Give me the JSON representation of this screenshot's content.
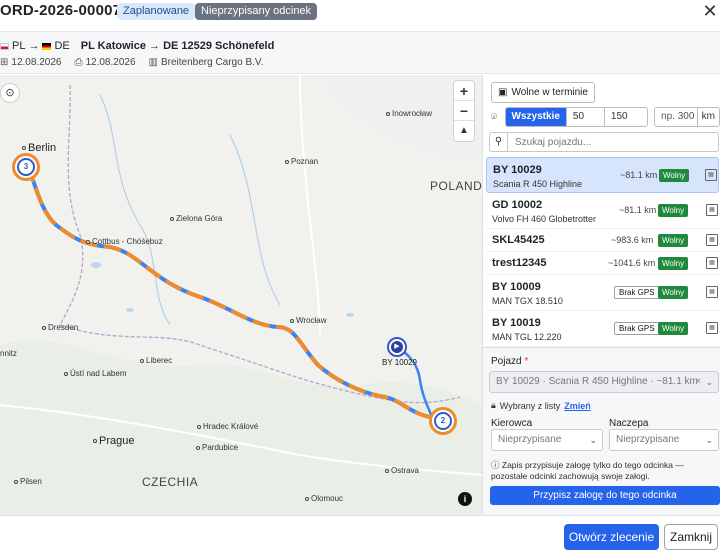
{
  "header": {
    "order_id": "ORD-2026-00007",
    "badge_planned": "Zaplanowane",
    "badge_unassigned": "Nieprzypisany odcinek",
    "close_icon": "close-icon"
  },
  "route": {
    "from_code": "PL",
    "to_code": "DE",
    "arrow": "→",
    "summary": "PL Katowice → DE 12529 Schönefeld",
    "pickup_date": "12.08.2026",
    "delivery_date": "12.08.2026",
    "client": "Breitenberg Cargo B.V."
  },
  "map": {
    "labels": {
      "berlin": "Berlin",
      "poznan": "Poznan",
      "poland": "POLAND",
      "inowroclaw": "Inowrocław",
      "zielona_gora": "Zielona Góra",
      "cottbus": "Cottbus - Chóśebuz",
      "wroclaw": "Wrocław",
      "dresden": "Dresden",
      "nnitz": "nnitz",
      "liberec": "Liberec",
      "usti": "Ústí nad Labem",
      "prague": "Prague",
      "hradec": "Hradec Králové",
      "pardubice": "Pardubice",
      "czechia": "CZECHIA",
      "plzen": "Pilsen",
      "ostrava": "Ostrava",
      "olomouc": "Olomouc"
    },
    "cluster_start": "3",
    "cluster_end": "2",
    "vehicle_marker_label": "BY 10029",
    "zoom_in": "+",
    "zoom_out": "−",
    "compass": "▲",
    "route_color": "#3b82f6",
    "route_highlight_color": "#f08a2a"
  },
  "filters": {
    "free_on_time": "Wolne w terminie",
    "radius_options": [
      "Wszystkie",
      "50 km",
      "150 km"
    ],
    "radius_active": "Wszystkie",
    "km_placeholder": "np. 300",
    "km_unit": "km",
    "search_placeholder": "Szukaj pojazdu..."
  },
  "vehicles": [
    {
      "plate": "BY 10029",
      "model": "Scania R 450 Highline",
      "distance": "~81.1 km",
      "status": "Wolny",
      "gps": "",
      "selected": true
    },
    {
      "plate": "GD 10002",
      "model": "Volvo FH 460 Globetrotter",
      "distance": "~81.1 km",
      "status": "Wolny",
      "gps": ""
    },
    {
      "plate": "SKL45425",
      "model": "",
      "distance": "~983.6 km",
      "status": "Wolny",
      "gps": ""
    },
    {
      "plate": "trest12345",
      "model": "",
      "distance": "~1041.6 km",
      "status": "Wolny",
      "gps": ""
    },
    {
      "plate": "BY 10009",
      "model": "MAN TGX 18.510",
      "distance": "",
      "status": "Wolny",
      "gps": "Brak GPS"
    },
    {
      "plate": "BY 10019",
      "model": "MAN TGL 12.220",
      "distance": "",
      "status": "Wolny",
      "gps": "Brak GPS"
    }
  ],
  "assign": {
    "vehicle_label": "Pojazd",
    "required_mark": "*",
    "vehicle_value": "BY 10029 · Scania R 450 Highline · ~81.1 km",
    "picked_text": "Wybrany z listy",
    "change_link": "Zmień",
    "driver_label": "Kierowca",
    "trailer_label": "Naczepa",
    "driver_placeholder": "Nieprzypisane",
    "trailer_placeholder": "Nieprzypisane",
    "note": "Zapis przypisuje załogę tylko do tego odcinka — pozostałe odcinki zachowują swoje załogi.",
    "assign_button": "Przypisz załogę do tego odcinka"
  },
  "footer": {
    "open_order": "Otwórz zlecenie",
    "close": "Zamknij"
  }
}
